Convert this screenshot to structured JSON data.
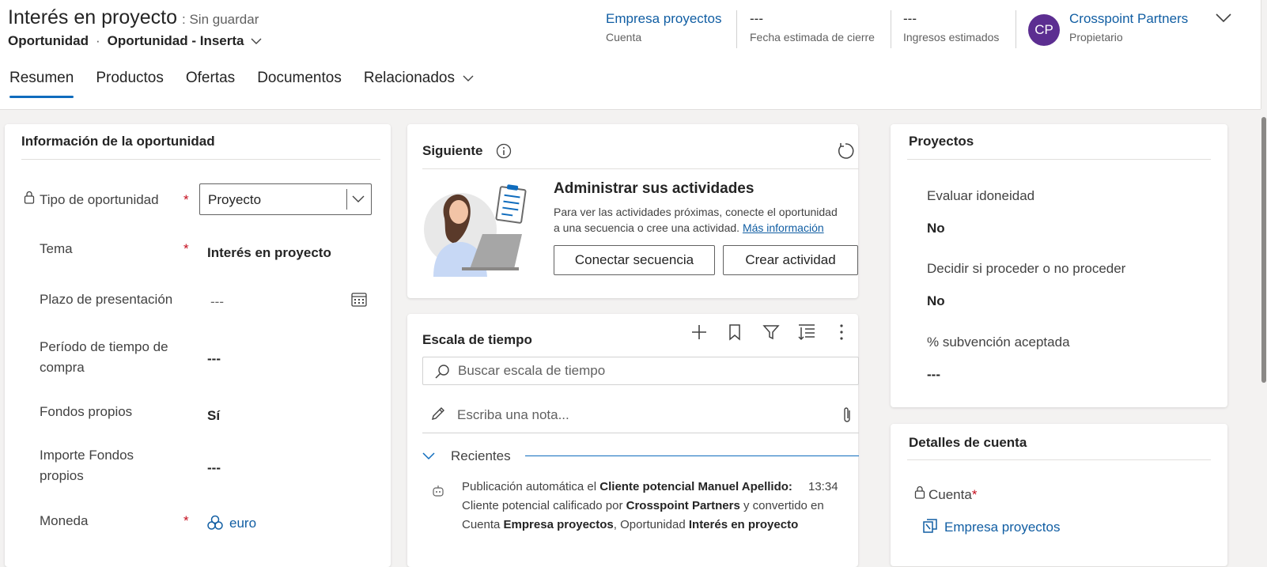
{
  "record": {
    "title": "Interés en proyecto",
    "status": ": Sin guardar",
    "entity": "Oportunidad",
    "form_name": "Oportunidad - Inserta"
  },
  "header_fields": [
    {
      "value": "Empresa proyectos",
      "label": "Cuenta"
    },
    {
      "value": "---",
      "label": "Fecha estimada de cierre"
    },
    {
      "value": "---",
      "label": "Ingresos estimados"
    },
    {
      "value": "Crosspoint Partners",
      "label": "Propietario",
      "initials": "CP",
      "avatar_color": "#5c2e91"
    }
  ],
  "tabs": [
    {
      "label": "Resumen",
      "active": true
    },
    {
      "label": "Productos"
    },
    {
      "label": "Ofertas"
    },
    {
      "label": "Documentos"
    },
    {
      "label": "Relacionados",
      "has_dropdown": true
    }
  ],
  "opportunity_info": {
    "title": "Información de la oportunidad",
    "required_marker": "*",
    "fields": [
      {
        "label": "Tipo de oportunidad",
        "value": "Proyecto",
        "locked": true,
        "required": true,
        "control": "select"
      },
      {
        "label": "Tema",
        "value": "Interés en proyecto",
        "required": true
      },
      {
        "label": "Plazo de presentación",
        "value": "---",
        "control": "date"
      },
      {
        "label_line1": "Período de tiempo de",
        "label_line2": "compra",
        "value": "---"
      },
      {
        "label": "Fondos propios",
        "value": "Sí"
      },
      {
        "label_line1": "Importe Fondos",
        "label_line2": "propios",
        "value": "---"
      },
      {
        "label": "Moneda",
        "value": "euro",
        "required": true,
        "control": "lookup"
      }
    ]
  },
  "next_card": {
    "title": "Siguiente",
    "heading": "Administrar sus actividades",
    "body_line1": "Para ver las actividades próximas, conecte el oportunidad",
    "body_line2": "a una secuencia o cree una actividad.",
    "link": "Más información",
    "button_connect": "Conectar secuencia",
    "button_create": "Crear actividad"
  },
  "timeline": {
    "title": "Escala de tiempo",
    "search_placeholder": "Buscar escala de tiempo",
    "note_placeholder": "Escriba una nota...",
    "section": "Recientes",
    "post": {
      "prefix": "Publicación automática el",
      "subject": "Cliente potencial Manuel Apellido:",
      "time": "13:34",
      "line2_a": "Cliente potencial calificado por",
      "line2_b": "Crosspoint Partners",
      "line2_c": "y convertido en",
      "line3_a": "Cuenta",
      "line3_b": "Empresa proyectos",
      "line3_c": ", Oportunidad",
      "line3_d": "Interés en proyecto"
    }
  },
  "projects": {
    "title": "Proyectos",
    "fields": [
      {
        "label": "Evaluar idoneidad",
        "value": "No"
      },
      {
        "label": "Decidir si proceder o no proceder",
        "value": "No"
      },
      {
        "label": "% subvención aceptada",
        "value": "---"
      }
    ]
  },
  "account_details": {
    "title": "Detalles de cuenta",
    "field_label": "Cuenta",
    "required_marker": "*",
    "value": "Empresa proyectos"
  },
  "colors": {
    "accent": "#0f6cbd",
    "link": "#115ea3",
    "required": "#c50f1f"
  }
}
